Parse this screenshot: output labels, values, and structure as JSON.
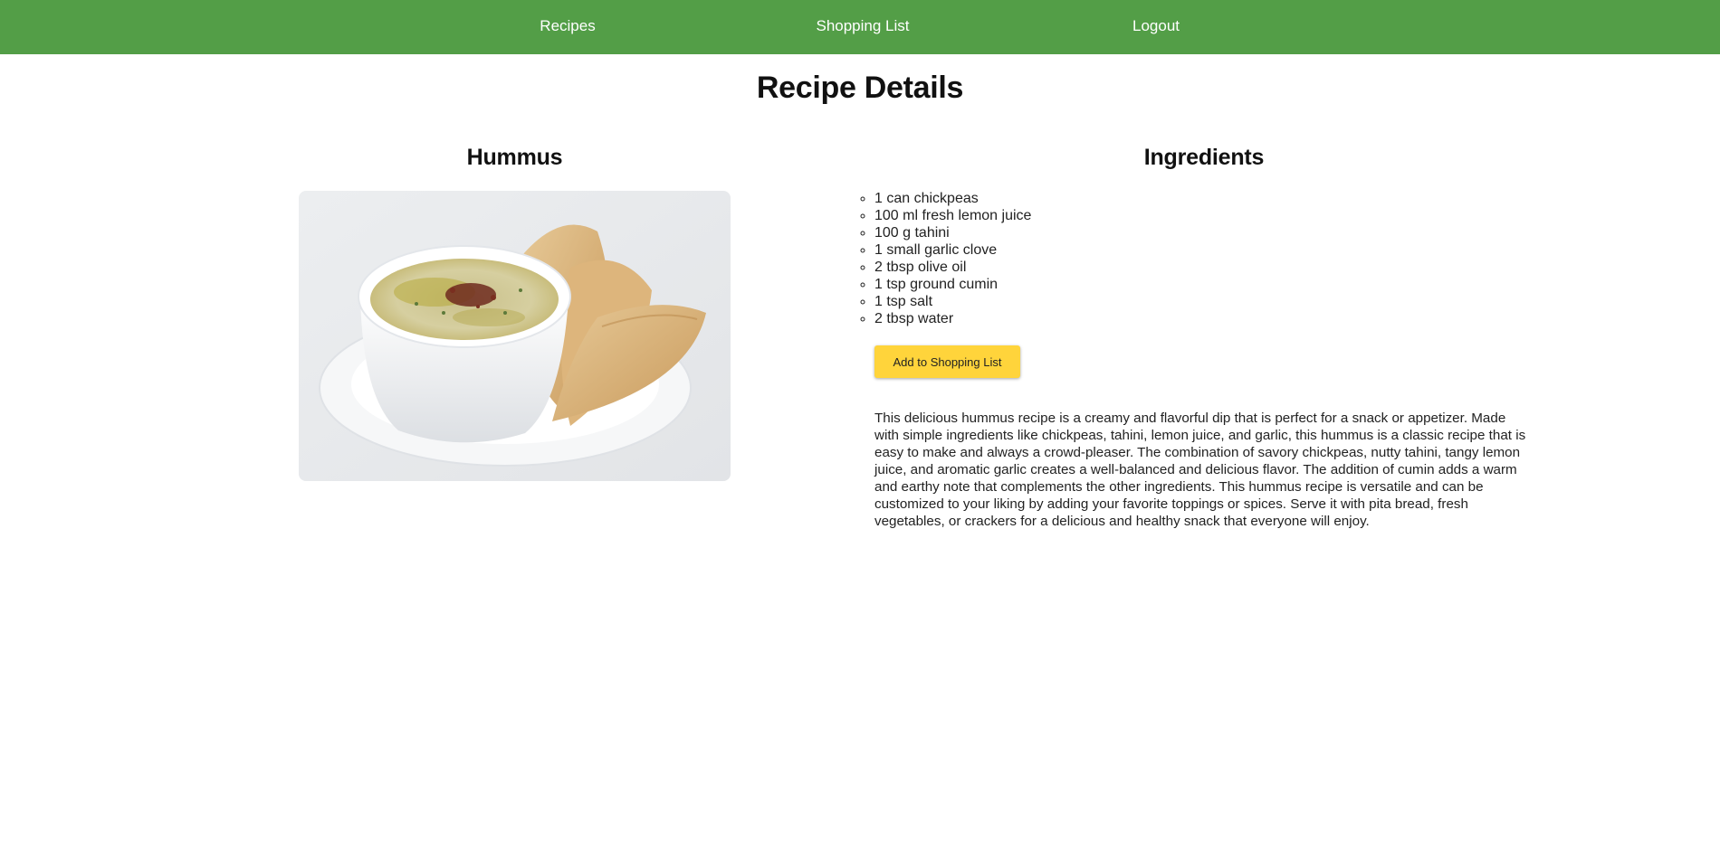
{
  "nav": {
    "recipes": "Recipes",
    "shopping_list": "Shopping List",
    "logout": "Logout"
  },
  "page": {
    "title": "Recipe Details"
  },
  "recipe": {
    "name": "Hummus",
    "ingredients_heading": "Ingredients",
    "ingredients": [
      "1 can chickpeas",
      "100 ml fresh lemon juice",
      "100 g tahini",
      "1 small garlic clove",
      "2 tbsp olive oil",
      "1 tsp ground cumin",
      "1 tsp salt",
      "2 tbsp water"
    ],
    "add_button_label": "Add to Shopping List",
    "description": "This delicious hummus recipe is a creamy and flavorful dip that is perfect for a snack or appetizer. Made with simple ingredients like chickpeas, tahini, lemon juice, and garlic, this hummus is a classic recipe that is easy to make and always a crowd-pleaser. The combination of savory chickpeas, nutty tahini, tangy lemon juice, and aromatic garlic creates a well-balanced and delicious flavor. The addition of cumin adds a warm and earthy note that complements the other ingredients. This hummus recipe is versatile and can be customized to your liking by adding your favorite toppings or spices. Serve it with pita bread, fresh vegetables, or crackers for a delicious and healthy snack that everyone will enjoy."
  },
  "colors": {
    "navbar": "#539e47",
    "button": "#ffd43b"
  }
}
